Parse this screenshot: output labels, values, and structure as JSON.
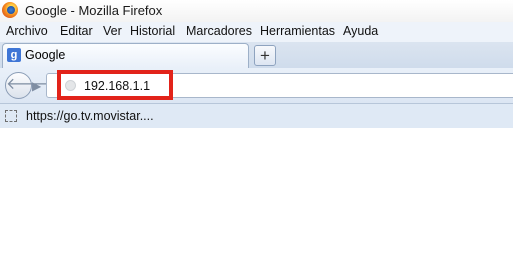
{
  "window": {
    "title": "Google - Mozilla Firefox"
  },
  "menu": [
    {
      "label": "Archivo"
    },
    {
      "label": "Editar"
    },
    {
      "label": "Ver"
    },
    {
      "label": "Historial"
    },
    {
      "label": "Marcadores"
    },
    {
      "label": "Herramientas"
    },
    {
      "label": "Ayuda"
    }
  ],
  "tabs": [
    {
      "label": "Google",
      "favicon": "g-icon"
    }
  ],
  "new_tab": {
    "label": "+"
  },
  "nav": {
    "back_icon": "back-arrow-icon",
    "forward_icon": "forward-arrow-icon",
    "url": "192.168.1.1",
    "highlight_color": "#e2231a"
  },
  "bookmarks": [
    {
      "label": "https://go.tv.movistar...."
    }
  ]
}
